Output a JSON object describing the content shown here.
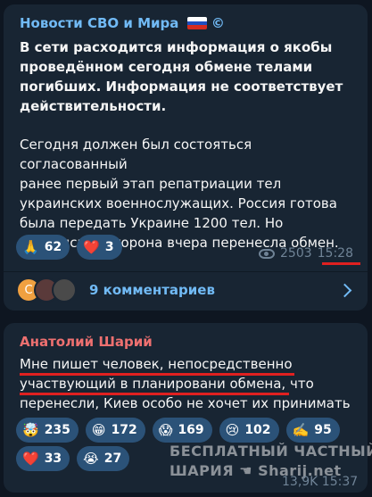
{
  "post1": {
    "channel": "Новости СВО и Мира",
    "channel_suffix": "©",
    "bold_lines": [
      "В сети расходится информация о якобы",
      "проведённом сегодня обмене телами",
      "погибших. Информация не соответствует",
      "действительности."
    ],
    "lines": [
      "Сегодня должен был состояться согласованный",
      "ранее первый этап репатриации тел",
      "украинских военнослужащих. Россия готова",
      "была передать Украине 1200 тел. Но",
      "украинская сторона вчера перенесла обмен."
    ],
    "reactions": [
      {
        "emoji": "🙏",
        "count": "62"
      },
      {
        "emoji": "❤️",
        "count": "3"
      }
    ],
    "views": "2503",
    "time": "15:28",
    "comments_avatar_letter": "С",
    "comments_label": "9 комментариев"
  },
  "post2": {
    "author": "Анатолий Шарий",
    "lines": [
      "Мне пишет человек, непосредственно",
      "участвующий в планировани обмена, что",
      "перенесли, Киев особо не хочет их принимать"
    ],
    "reactions_row1": [
      {
        "emoji": "🤯",
        "count": "235"
      },
      {
        "emoji": "😁",
        "count": "172"
      },
      {
        "emoji": "😱",
        "count": "169"
      },
      {
        "emoji": "😢",
        "count": "102"
      },
      {
        "emoji": "✍️",
        "count": "95"
      }
    ],
    "reactions_row2": [
      {
        "emoji": "❤️",
        "count": "33"
      },
      {
        "emoji": "😭",
        "count": "27"
      }
    ],
    "watermark_line1": "БЕСПЛАТНЫЙ ЧАСТНЫЙ",
    "watermark_line2": "ШАРИЯ ☚ Sharij.net",
    "views_time": "13,9K 15:37"
  },
  "colors": {
    "background": "#0e1621",
    "bubble": "#182533",
    "link": "#71baf5",
    "author": "#ee7070",
    "reaction_bg": "#2b5278",
    "underline": "#e02020"
  }
}
